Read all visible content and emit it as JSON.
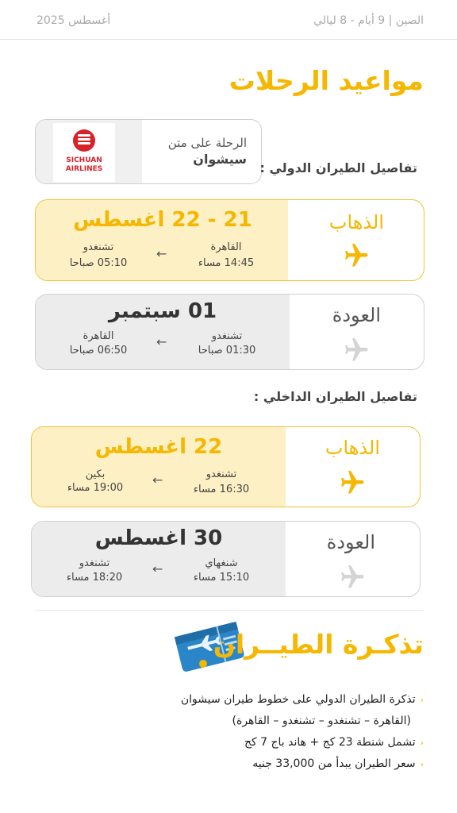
{
  "header": {
    "trip": "الصين | 9 أيام - 8 ليالي",
    "month": "أغسطس 2025"
  },
  "title": "مواعيد الرحلات",
  "airline": {
    "line1": "الرحلة على متن",
    "line2": "سيشوان",
    "logo_text_1": "SICHUAN",
    "logo_text_2": "AIRLINES"
  },
  "international": {
    "label": "تفاصيل الطيران الدولي :",
    "departure": {
      "label": "الذهاب",
      "date": "21 - 22 اغسطس",
      "from_city": "القاهرة",
      "from_time": "14:45 مساء",
      "to_city": "تشنغدو",
      "to_time": "05:10 صباحا",
      "arrow": "←"
    },
    "return": {
      "label": "العودة",
      "date": "01 سبتمبر",
      "from_city": "تشنغدو",
      "from_time": "01:30 صباحا",
      "to_city": "القاهرة",
      "to_time": "06:50 صباحا",
      "arrow": "←"
    }
  },
  "domestic": {
    "label": "تفاصيل الطيران الداخلي :",
    "departure": {
      "label": "الذهاب",
      "date": "22 اغسطس",
      "from_city": "تشنغدو",
      "from_time": "16:30 مساء",
      "to_city": "بكين",
      "to_time": "19:00 مساء",
      "arrow": "←"
    },
    "return": {
      "label": "العودة",
      "date": "30 اغسطس",
      "from_city": "شنغهاي",
      "from_time": "15:10 مساء",
      "to_city": "تشنغدو",
      "to_time": "18:20 مساء",
      "arrow": "←"
    }
  },
  "ticket": {
    "title": "تذكـرة الطيــران",
    "notes": [
      "تذكرة الطيران الدولي على خطوط طيران سيشوان",
      "(القاهرة – تشنغدو – تشنغدو – القاهرة)",
      "تشمل شنطة 23 كج + هاند باج 7 كج",
      "سعر الطيران يبدأ من 33,000 جنيه"
    ]
  },
  "colors": {
    "accent": "#f5b700",
    "dep_bg": "#fdf0c4",
    "ret_bg": "#ececec",
    "ret_plane": "#d4d4d4"
  },
  "icons": {
    "plane": "airplane-icon",
    "ticket": "flight-ticket-icon",
    "bullet": "chevron-left-icon"
  }
}
